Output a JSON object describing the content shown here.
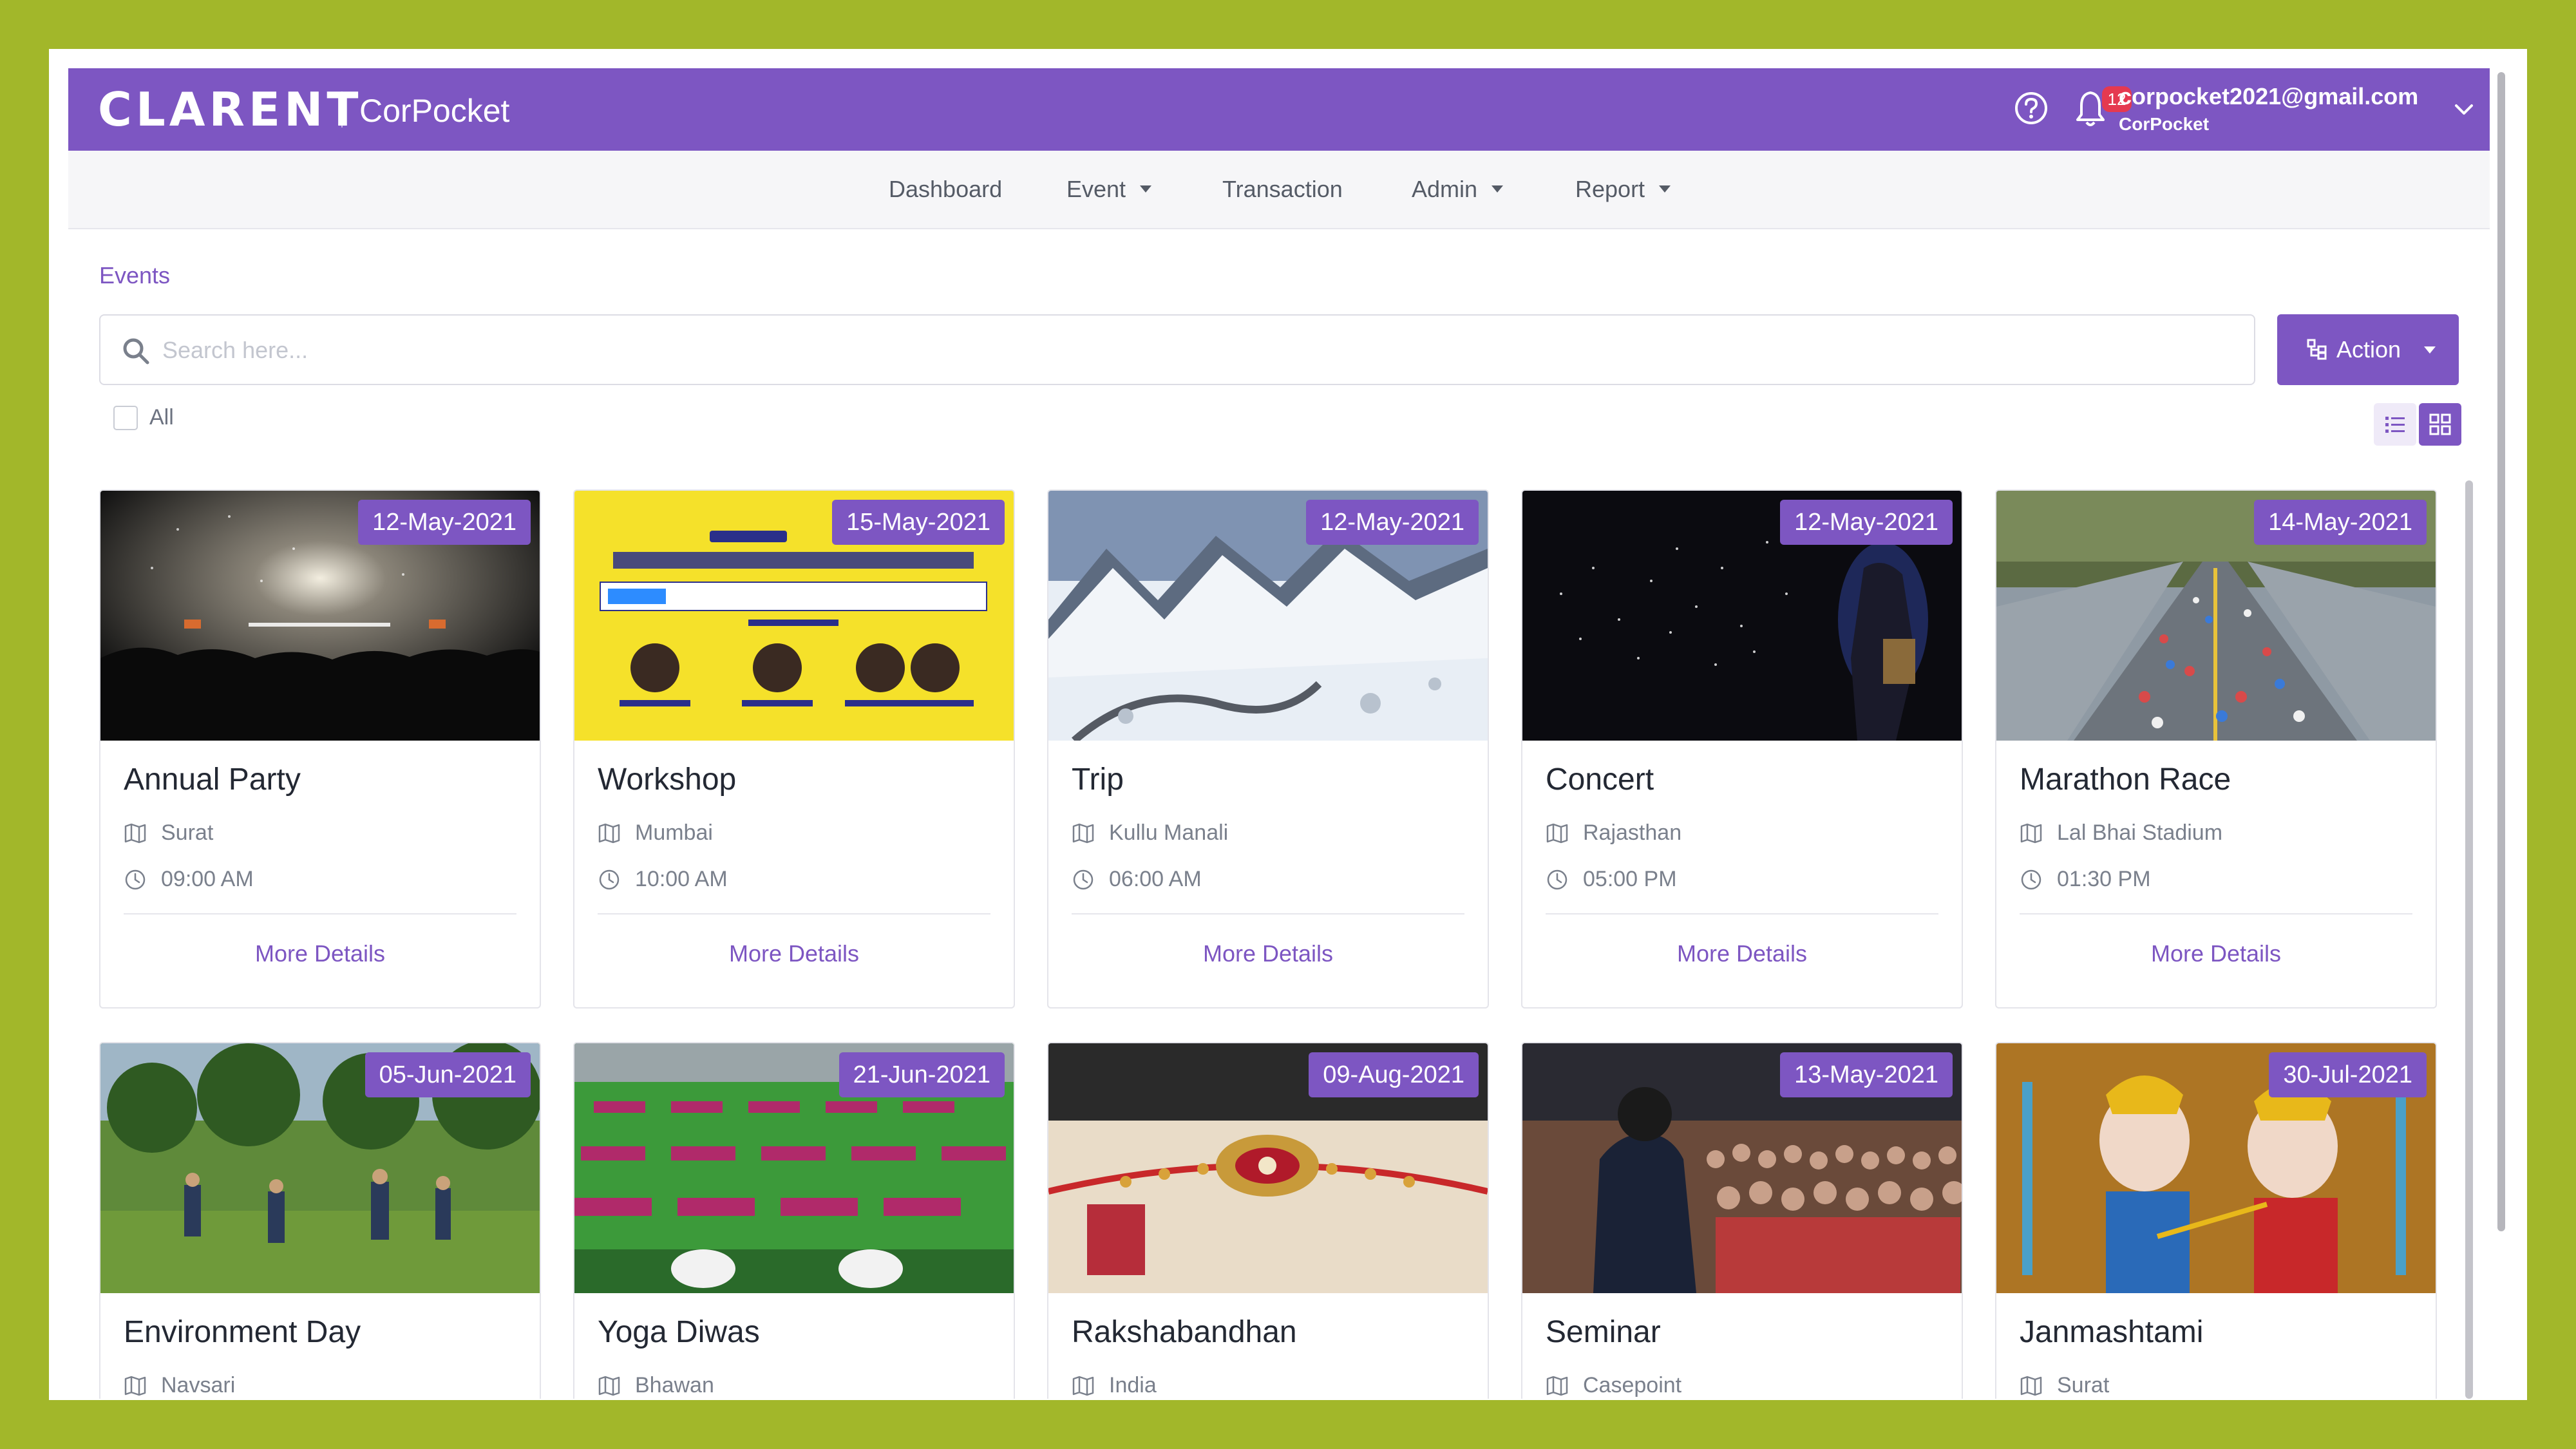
{
  "colors": {
    "accent": "#7d56c2",
    "frame": "#a2b72a",
    "badge": "#e53950"
  },
  "header": {
    "logo": "CLARENT",
    "app_name": "CorPocket",
    "notification_count": "12",
    "user_email": "corpocket2021@gmail.com",
    "user_org": "CorPocket"
  },
  "nav": {
    "items": [
      {
        "label": "Dashboard",
        "dropdown": false
      },
      {
        "label": "Event",
        "dropdown": true
      },
      {
        "label": "Transaction",
        "dropdown": false
      },
      {
        "label": "Admin",
        "dropdown": true
      },
      {
        "label": "Report",
        "dropdown": true
      }
    ]
  },
  "page": {
    "title": "Events",
    "search_placeholder": "Search here...",
    "action_label": "Action",
    "select_all_label": "All",
    "view_mode": "grid"
  },
  "events": [
    {
      "title": "Annual Party",
      "date": "12-May-2021",
      "location": "Surat",
      "time": "09:00 AM",
      "more": "More Details",
      "image": "party-crowd"
    },
    {
      "title": "Workshop",
      "date": "15-May-2021",
      "location": "Mumbai",
      "time": "10:00 AM",
      "more": "More Details",
      "image": "webinar-poster"
    },
    {
      "title": "Trip",
      "date": "12-May-2021",
      "location": "Kullu Manali",
      "time": "06:00 AM",
      "more": "More Details",
      "image": "snowy-mountains"
    },
    {
      "title": "Concert",
      "date": "12-May-2021",
      "location": "Rajasthan",
      "time": "05:00 PM",
      "more": "More Details",
      "image": "concert-lights"
    },
    {
      "title": "Marathon Race",
      "date": "14-May-2021",
      "location": "Lal Bhai Stadium",
      "time": "01:30 PM",
      "more": "More Details",
      "image": "marathon-road"
    },
    {
      "title": "Environment Day",
      "date": "05-Jun-2021",
      "location": "Navsari",
      "image": "tree-planting"
    },
    {
      "title": "Yoga Diwas",
      "date": "21-Jun-2021",
      "location": "Bhawan",
      "image": "yoga-mats"
    },
    {
      "title": "Rakshabandhan",
      "date": "09-Aug-2021",
      "location": "India",
      "image": "rakhi"
    },
    {
      "title": "Seminar",
      "date": "13-May-2021",
      "location": "Casepoint",
      "image": "seminar-audience"
    },
    {
      "title": "Janmashtami",
      "date": "30-Jul-2021",
      "location": "Surat",
      "image": "krishna-idol"
    }
  ]
}
